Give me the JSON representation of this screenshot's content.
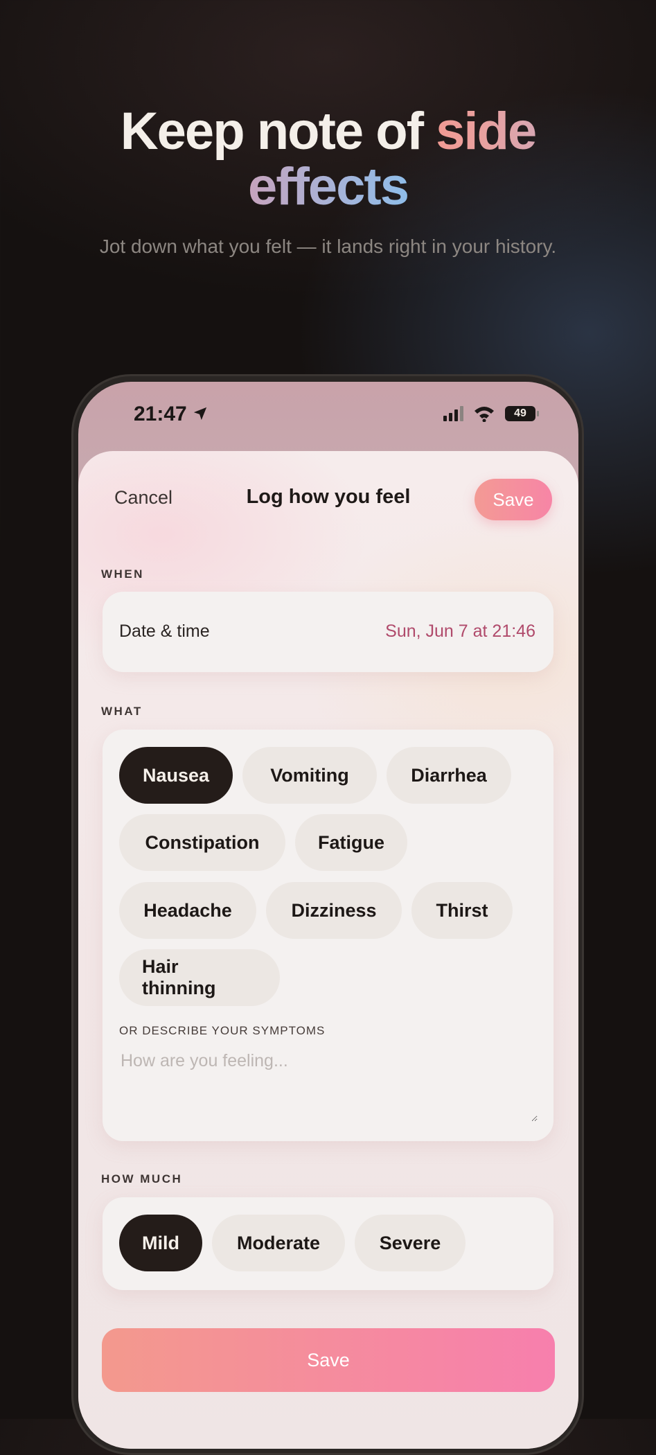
{
  "hero": {
    "title_part1": "Keep note of ",
    "title_accent1": "side",
    "title_accent2": "effects",
    "subtitle": "Jot down what you felt — it lands right in your history."
  },
  "status_bar": {
    "time": "21:47",
    "battery": "49"
  },
  "nav": {
    "cancel": "Cancel",
    "title": "Log how you feel",
    "save": "Save"
  },
  "when": {
    "section_label": "WHEN",
    "row_label": "Date & time",
    "row_value": "Sun, Jun 7 at 21:46"
  },
  "what": {
    "section_label": "WHAT",
    "chips": [
      "Nausea",
      "Vomiting",
      "Diarrhea",
      "Constipation",
      "Fatigue",
      "Headache",
      "Dizziness",
      "Thirst",
      "Hair thinning"
    ],
    "selected": "Nausea",
    "describe_label": "OR DESCRIBE YOUR SYMPTOMS",
    "describe_placeholder": "How are you feeling...",
    "describe_value": ""
  },
  "how_much": {
    "section_label": "HOW MUCH",
    "options": [
      "Mild",
      "Moderate",
      "Severe"
    ],
    "selected": "Mild"
  },
  "footer": {
    "save": "Save"
  },
  "colors": {
    "accent_pink": "#f785a6",
    "accent_coral": "#f39a94",
    "date_value": "#b04a6b",
    "selected_chip": "#241c19"
  }
}
